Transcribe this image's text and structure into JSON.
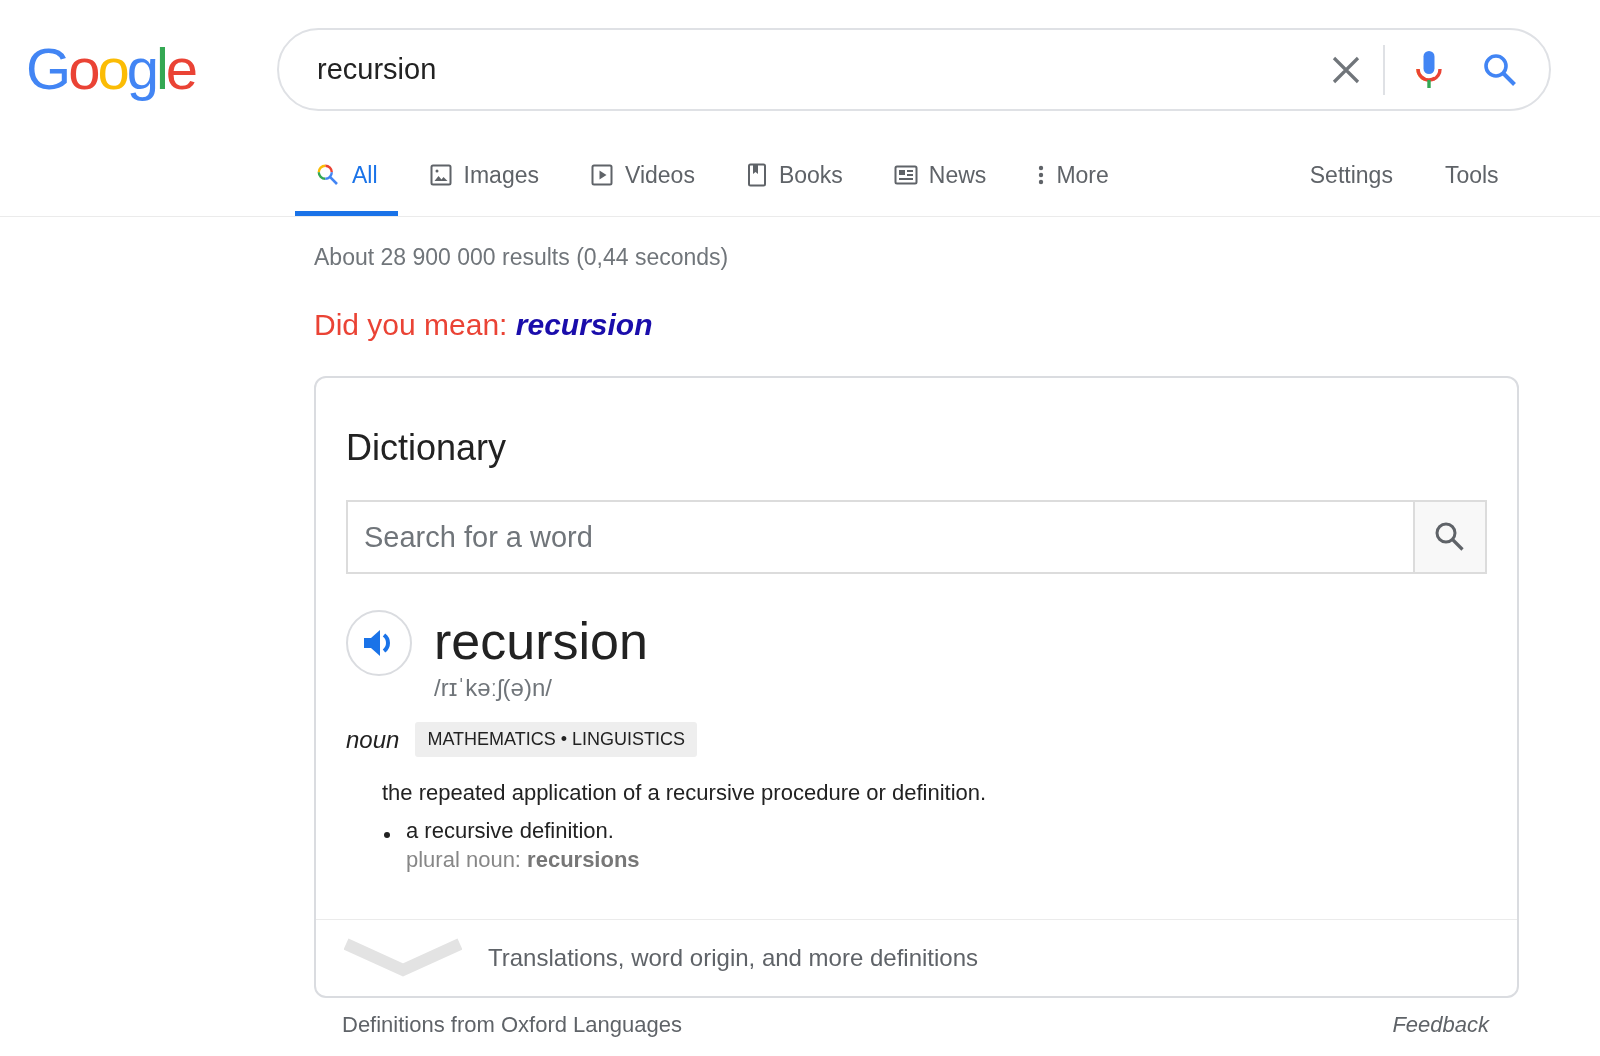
{
  "logo": {
    "text": "Google"
  },
  "search": {
    "value": "recursion"
  },
  "tabs": [
    {
      "label": "All",
      "kind": "search",
      "selected": true
    },
    {
      "label": "Images",
      "kind": "image",
      "selected": false
    },
    {
      "label": "Videos",
      "kind": "video",
      "selected": false
    },
    {
      "label": "Books",
      "kind": "book",
      "selected": false
    },
    {
      "label": "News",
      "kind": "news",
      "selected": false
    },
    {
      "label": "More",
      "kind": "more",
      "selected": false
    }
  ],
  "tools": [
    "Settings",
    "Tools"
  ],
  "result_stats": "About 28 900 000 results (0,44 seconds)",
  "spelling": {
    "prompt": "Did you mean:",
    "suggestion": "recursion"
  },
  "dictionary": {
    "title": "Dictionary",
    "search": {
      "placeholder": "Search for a word"
    },
    "word": "recursion",
    "phonetic": "/rɪˈkəːʃ(ə)n/",
    "part_of_speech": "noun",
    "tags": "MATHEMATICS • LINGUISTICS",
    "definition": "the repeated application of a recursive procedure or definition.",
    "sub_definition": "a recursive definition.",
    "plural": "plural noun: **recursions**",
    "more_link": "Translations, word origin, and more definitions"
  },
  "footer": {
    "source": "Definitions from Oxford Languages",
    "feedback": "Feedback"
  }
}
